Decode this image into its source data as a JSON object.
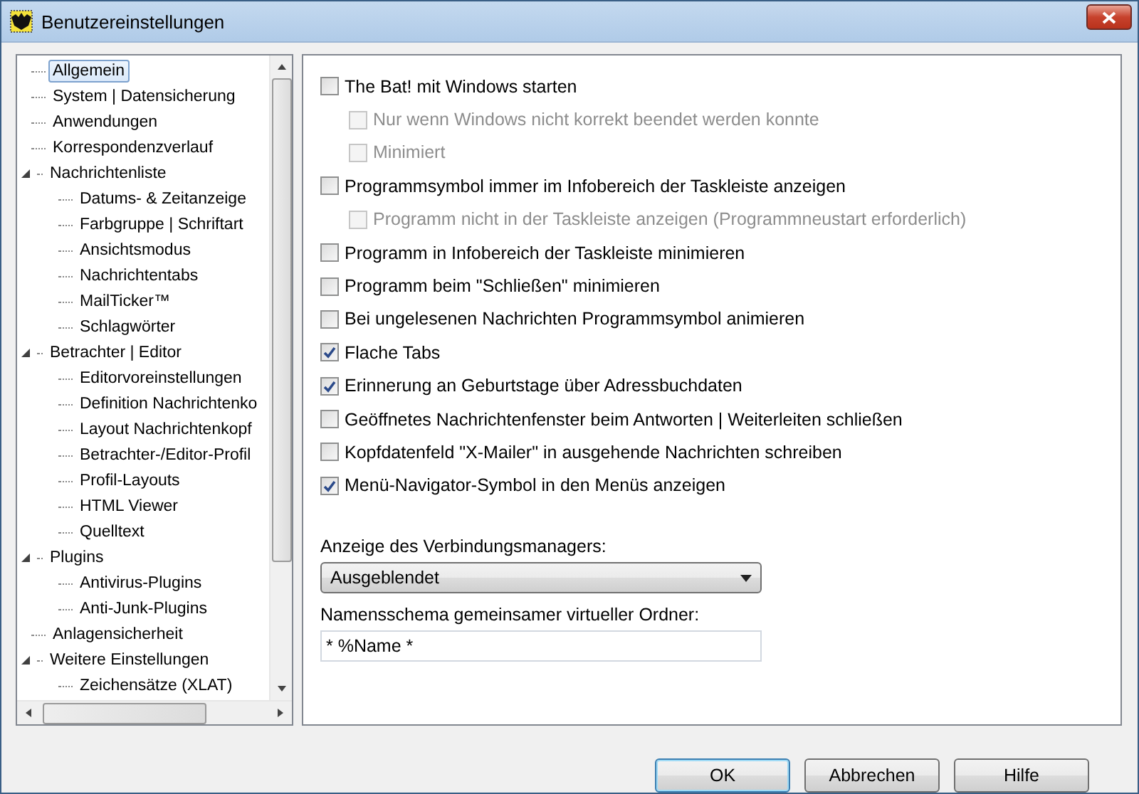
{
  "window": {
    "title": "Benutzereinstellungen"
  },
  "tree": [
    {
      "label": "Allgemein",
      "selected": true
    },
    {
      "label": "System | Datensicherung",
      "selected": false
    },
    {
      "label": "Anwendungen",
      "selected": false
    },
    {
      "label": "Korrespondenzverlauf",
      "selected": false
    },
    {
      "label": "Nachrichtenliste",
      "selected": false,
      "expanded": true,
      "children": [
        {
          "label": "Datums- & Zeitanzeige",
          "selected": false
        },
        {
          "label": "Farbgruppe | Schriftart",
          "selected": false
        },
        {
          "label": "Ansichtsmodus",
          "selected": false
        },
        {
          "label": "Nachrichtentabs",
          "selected": false
        },
        {
          "label": "MailTicker™",
          "selected": false
        },
        {
          "label": "Schlagwörter",
          "selected": false
        }
      ]
    },
    {
      "label": "Betrachter | Editor",
      "selected": false,
      "expanded": true,
      "children": [
        {
          "label": "Editorvoreinstellungen",
          "selected": false
        },
        {
          "label": "Definition Nachrichtenko",
          "selected": false
        },
        {
          "label": "Layout Nachrichtenkopf",
          "selected": false
        },
        {
          "label": "Betrachter-/Editor-Profil",
          "selected": false
        },
        {
          "label": "Profil-Layouts",
          "selected": false
        },
        {
          "label": "HTML Viewer",
          "selected": false
        },
        {
          "label": "Quelltext",
          "selected": false
        }
      ]
    },
    {
      "label": "Plugins",
      "selected": false,
      "expanded": true,
      "children": [
        {
          "label": "Antivirus-Plugins",
          "selected": false
        },
        {
          "label": "Anti-Junk-Plugins",
          "selected": false
        }
      ]
    },
    {
      "label": "Anlagensicherheit",
      "selected": false
    },
    {
      "label": "Weitere Einstellungen",
      "selected": false,
      "expanded": true,
      "children": [
        {
          "label": "Zeichensätze (XLAT)",
          "selected": false
        }
      ]
    }
  ],
  "options": [
    {
      "label": "The Bat! mit Windows starten",
      "checked": false,
      "disabled": false,
      "children": [
        {
          "label": "Nur wenn Windows nicht korrekt beendet werden konnte",
          "checked": false,
          "disabled": true
        },
        {
          "label": "Minimiert",
          "checked": false,
          "disabled": true
        }
      ]
    },
    {
      "label": "Programmsymbol immer im Infobereich der Taskleiste anzeigen",
      "checked": false,
      "disabled": false,
      "children": [
        {
          "label": "Programm nicht in der Taskleiste anzeigen (Programmneustart erforderlich)",
          "checked": false,
          "disabled": true
        }
      ]
    },
    {
      "label": "Programm in Infobereich der Taskleiste minimieren",
      "checked": false,
      "disabled": false
    },
    {
      "label": "Programm beim \"Schließen\" minimieren",
      "checked": false,
      "disabled": false
    },
    {
      "label": "Bei ungelesenen Nachrichten Programmsymbol animieren",
      "checked": false,
      "disabled": false
    },
    {
      "label": "Flache Tabs",
      "checked": true,
      "disabled": false
    },
    {
      "label": "Erinnerung an Geburtstage über Adressbuchdaten",
      "checked": true,
      "disabled": false
    },
    {
      "label": "Geöffnetes Nachrichtenfenster beim Antworten | Weiterleiten schließen",
      "checked": false,
      "disabled": false
    },
    {
      "label": "Kopfdatenfeld \"X-Mailer\" in ausgehende Nachrichten schreiben",
      "checked": false,
      "disabled": false
    },
    {
      "label": "Menü-Navigator-Symbol in den Menüs anzeigen",
      "checked": true,
      "disabled": false
    }
  ],
  "connection_manager": {
    "label": "Anzeige des Verbindungsmanagers:",
    "value": "Ausgeblendet"
  },
  "folder_naming": {
    "label": "Namensschema gemeinsamer virtueller Ordner:",
    "value": "* %Name *"
  },
  "buttons": [
    {
      "label": "OK",
      "default": true
    },
    {
      "label": "Abbrechen",
      "default": false
    },
    {
      "label": "Hilfe",
      "default": false
    }
  ]
}
